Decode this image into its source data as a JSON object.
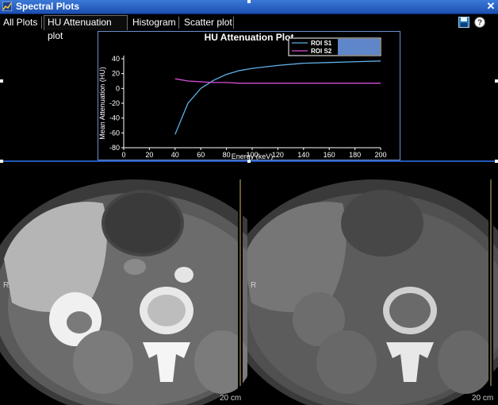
{
  "window": {
    "title": "Spectral Plots",
    "close_glyph": "✕"
  },
  "tabs": [
    {
      "label": "All Plots",
      "active": false
    },
    {
      "label": "HU Attenuation plot",
      "active": true
    },
    {
      "label": "Histogram",
      "active": false
    },
    {
      "label": "Scatter plot",
      "active": false
    }
  ],
  "toolbar": {
    "icons": [
      "save-icon",
      "help-icon"
    ]
  },
  "chart_data": {
    "type": "line",
    "title": "HU Attenuation Plot",
    "xlabel": "Energy (keV)",
    "ylabel": "Mean Attenuation (HU)",
    "xlim": [
      0,
      200
    ],
    "ylim": [
      -80,
      40
    ],
    "xticks": [
      0,
      20,
      40,
      60,
      80,
      100,
      120,
      140,
      160,
      180,
      200
    ],
    "yticks": [
      40,
      20,
      0,
      -20,
      -40,
      -60,
      -80
    ],
    "legend_position": "top-right",
    "series": [
      {
        "name": "ROI S1",
        "color": "#5fb0e8",
        "x": [
          40,
          50,
          60,
          70,
          80,
          90,
          100,
          120,
          140,
          160,
          180,
          200
        ],
        "values": [
          -62,
          -20,
          0,
          11,
          19,
          24,
          27,
          31,
          34,
          35,
          36,
          37
        ]
      },
      {
        "name": "ROI S2",
        "color": "#d64fd6",
        "x": [
          40,
          50,
          60,
          70,
          80,
          90,
          100,
          120,
          140,
          160,
          180,
          200
        ],
        "values": [
          13,
          10,
          9,
          8,
          8,
          7,
          7,
          7,
          7,
          7,
          7,
          7
        ]
      }
    ]
  },
  "images": {
    "left_scale": "20 cm",
    "right_scale": "20 cm",
    "left_orientation": "R",
    "right_orientation": "R"
  }
}
